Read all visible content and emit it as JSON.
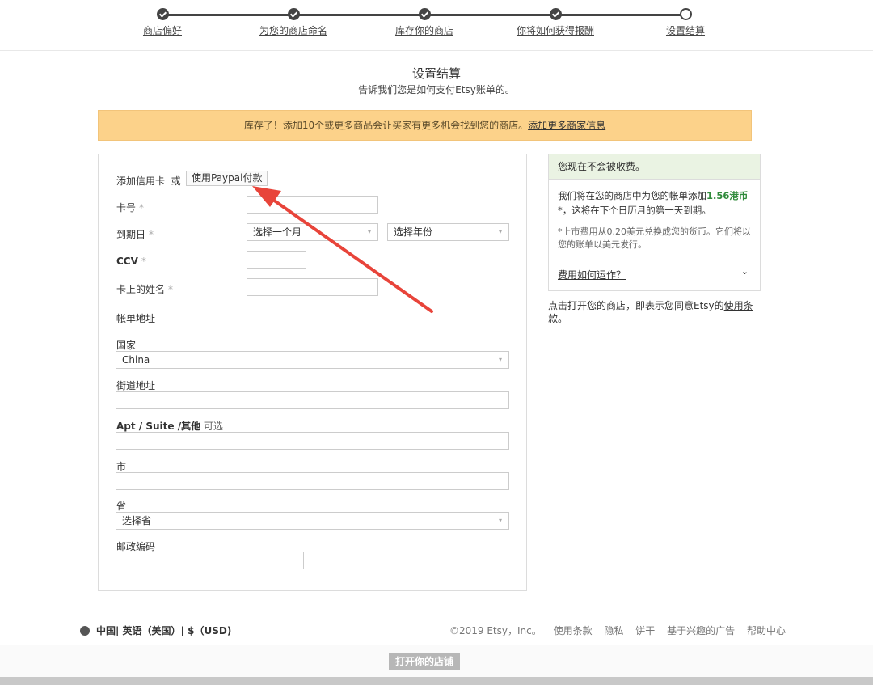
{
  "progress": {
    "steps": [
      {
        "label": "商店偏好",
        "done": true
      },
      {
        "label": "为您的商店命名",
        "done": true
      },
      {
        "label": "库存你的商店",
        "done": true
      },
      {
        "label": "你将如何获得报酬",
        "done": true
      },
      {
        "label": "设置结算",
        "done": false
      }
    ]
  },
  "header": {
    "title": "设置结算",
    "subtitle": "告诉我们您是如何支付Etsy账单的。"
  },
  "banner": {
    "text": "库存了！添加10个或更多商品会让买家有更多机会找到您的商店。",
    "link": "添加更多商家信息"
  },
  "form": {
    "add_card_label": "添加信用卡",
    "or_label": "或",
    "paypal_button": "使用Paypal付款",
    "card_number_label": "卡号",
    "required_mark": "*",
    "expiry_label": "到期日",
    "month_select": "选择一个月",
    "year_select": "选择年份",
    "ccv_label": "CCV",
    "name_on_card_label": "卡上的姓名",
    "billing_address_label": "帐单地址",
    "country_label": "国家",
    "country_value": "China",
    "street_label": "街道地址",
    "apt_label": "Apt / Suite /其他",
    "optional_label": "可选",
    "city_label": "市",
    "province_label": "省",
    "province_select": "选择省",
    "postal_label": "邮政编码"
  },
  "side": {
    "header": "您现在不会被收费。",
    "text_before": "我们将在您的商店中为您的帐单添加",
    "amount": "1.56港币",
    "text_after": "*，这将在下个日历月的第一天到期。",
    "note": "*上市费用从0.20美元兑换成您的货币。它们将以您的账单以美元发行。",
    "how_fees_link": "费用如何运作？"
  },
  "agree": {
    "text": "点击打开您的商店，即表示您同意Etsy的",
    "link": "使用条款",
    "end": "。"
  },
  "footer": {
    "locale": "中国| 英语（美国）| $（USD)",
    "copyright": "©2019 Etsy，Inc。",
    "links": [
      "使用条款",
      "隐私",
      "饼干",
      "基于兴趣的广告",
      "帮助中心"
    ],
    "open_shop_button": "打开你的店铺"
  },
  "colors": {
    "banner_bg": "#fcd28a",
    "side_header_bg": "#eaf3e3",
    "accent_green": "#2f8a3a",
    "arrow_red": "#e8443a"
  }
}
